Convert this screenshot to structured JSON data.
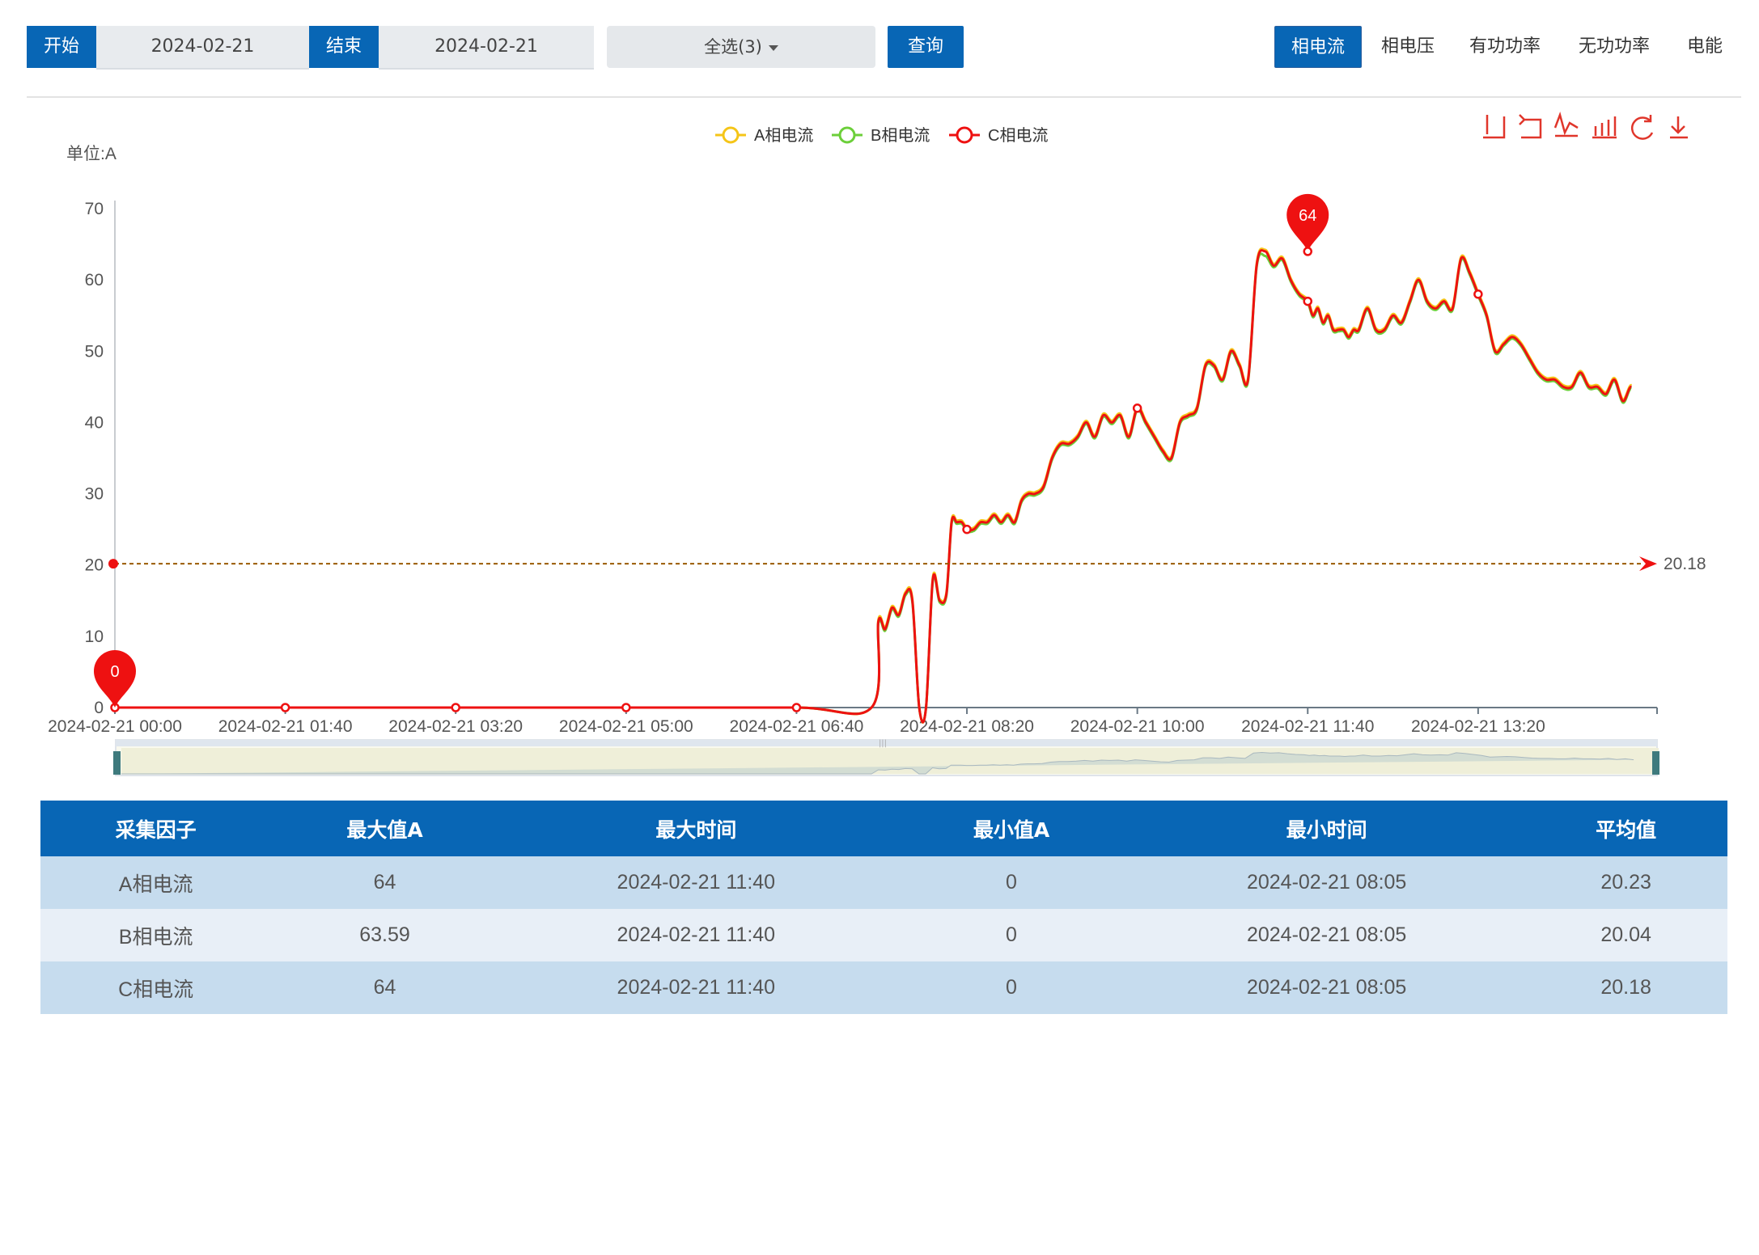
{
  "toolbar": {
    "start_label": "开始",
    "start_date": "2024-02-21",
    "end_label": "结束",
    "end_date": "2024-02-21",
    "select_value": "全选(3)",
    "query_label": "查询",
    "tabs": [
      "相电流",
      "相电压",
      "有功功率",
      "无功功率",
      "电能"
    ],
    "active_tab": 0
  },
  "chart_data": {
    "type": "line",
    "unit_label": "单位:A",
    "ylim": [
      0,
      70
    ],
    "y_ticks": [
      0,
      10,
      20,
      30,
      40,
      50,
      60,
      70
    ],
    "x_tick_labels": [
      "2024-02-21 00:00",
      "2024-02-21 01:40",
      "2024-02-21 03:20",
      "2024-02-21 05:00",
      "2024-02-21 06:40",
      "2024-02-21 08:20",
      "2024-02-21 10:00",
      "2024-02-21 11:40",
      "2024-02-21 13:20"
    ],
    "x_range_minutes": [
      0,
      905
    ],
    "legend": [
      {
        "name": "A相电流",
        "color": "#f5c518"
      },
      {
        "name": "B相电流",
        "color": "#6ccf3a"
      },
      {
        "name": "C相电流",
        "color": "#ee1111"
      }
    ],
    "max_marker": {
      "label": "64",
      "time": "2024-02-21 11:40",
      "value": 64
    },
    "min_marker": {
      "label": "0",
      "time": "2024-02-21 00:00",
      "value": 0
    },
    "average_line": {
      "value": 20.18,
      "label": "20.18"
    },
    "series_times_min": [
      0,
      100,
      200,
      300,
      400,
      444,
      448,
      452,
      456,
      460,
      464,
      468,
      472,
      476,
      480,
      484,
      488,
      491,
      494,
      497,
      500,
      504,
      508,
      512,
      516,
      520,
      524,
      528,
      532,
      536,
      540,
      545,
      550,
      555,
      560,
      565,
      570,
      575,
      580,
      585,
      590,
      595,
      600,
      605,
      610,
      615,
      620,
      625,
      630,
      635,
      640,
      645,
      650,
      655,
      660,
      665,
      670,
      675,
      680,
      685,
      690,
      695,
      700,
      703,
      706,
      709,
      712,
      715,
      718,
      721,
      724,
      727,
      730,
      735,
      740,
      745,
      750,
      755,
      760,
      765,
      770,
      775,
      780,
      785,
      790,
      795,
      800,
      805,
      810,
      815,
      820,
      825,
      830,
      835,
      840,
      845,
      850,
      855,
      860,
      865,
      870,
      875,
      880,
      885,
      890,
      895,
      900,
      905
    ],
    "series_C": [
      0,
      0,
      0,
      0,
      0,
      0,
      12,
      11,
      14,
      13,
      16,
      15,
      0,
      0,
      18,
      15,
      16,
      26,
      26,
      26,
      25,
      25,
      26,
      26,
      27,
      26,
      27,
      26,
      29,
      30,
      30,
      31,
      35,
      37,
      37,
      38,
      40,
      38,
      41,
      40,
      41,
      38,
      42,
      40,
      38,
      36,
      35,
      40,
      41,
      42,
      48,
      48,
      46,
      50,
      48,
      46,
      62,
      64,
      62,
      63,
      60,
      58,
      57,
      55,
      56,
      54,
      55,
      53,
      53,
      53,
      52,
      53,
      53,
      56,
      53,
      53,
      55,
      54,
      57,
      60,
      57,
      56,
      57,
      56,
      63,
      61,
      58,
      55,
      50,
      51,
      52,
      51,
      49,
      47,
      46,
      46,
      45,
      45,
      47,
      45,
      45,
      44,
      46,
      43,
      45,
      42
    ],
    "series_A": [
      0,
      0,
      0,
      0,
      0,
      0,
      12,
      11,
      14,
      13,
      16,
      15,
      0,
      0,
      18,
      15,
      16,
      26,
      26,
      26,
      25,
      25,
      26,
      26,
      27,
      26,
      27,
      26,
      29,
      30,
      30,
      31,
      35,
      37,
      37,
      38,
      40,
      38,
      41,
      40,
      41,
      38,
      42,
      40,
      38,
      36,
      35,
      40,
      41,
      42,
      48,
      48,
      46,
      50,
      48,
      46,
      62,
      64,
      62,
      63,
      60,
      58,
      57,
      55,
      56,
      54,
      55,
      53,
      53,
      53,
      52,
      53,
      53,
      56,
      53,
      53,
      55,
      54,
      57,
      60,
      57,
      56,
      57,
      56,
      63,
      61,
      58,
      55,
      50,
      51,
      52,
      51,
      49,
      47,
      46,
      46,
      45,
      45,
      47,
      45,
      45,
      44,
      46,
      43,
      45,
      42
    ],
    "series_B": [
      0,
      0,
      0,
      0,
      0,
      0,
      12,
      11,
      14,
      13,
      16,
      15,
      0,
      0,
      18,
      15,
      16,
      26,
      26,
      26,
      25,
      25,
      26,
      26,
      27,
      26,
      27,
      26,
      29,
      30,
      30,
      31,
      35,
      37,
      37,
      38,
      40,
      38,
      41,
      40,
      41,
      38,
      42,
      40,
      38,
      36,
      35,
      40,
      41,
      42,
      48,
      48,
      46,
      50,
      48,
      46,
      62,
      63.59,
      62,
      63,
      60,
      58,
      57,
      55,
      56,
      54,
      55,
      53,
      53,
      53,
      52,
      53,
      53,
      56,
      53,
      53,
      55,
      54,
      57,
      60,
      57,
      56,
      57,
      56,
      63,
      61,
      58,
      55,
      50,
      51,
      52,
      51,
      49,
      47,
      46,
      46,
      45,
      45,
      47,
      45,
      45,
      44,
      46,
      43,
      45,
      42
    ]
  },
  "table": {
    "headers": [
      "采集因子",
      "最大值A",
      "最大时间",
      "最小值A",
      "最小时间",
      "平均值"
    ],
    "rows": [
      [
        "A相电流",
        "64",
        "2024-02-21 11:40",
        "0",
        "2024-02-21 08:05",
        "20.23"
      ],
      [
        "B相电流",
        "63.59",
        "2024-02-21 11:40",
        "0",
        "2024-02-21 08:05",
        "20.04"
      ],
      [
        "C相电流",
        "64",
        "2024-02-21 11:40",
        "0",
        "2024-02-21 08:05",
        "20.18"
      ]
    ]
  }
}
